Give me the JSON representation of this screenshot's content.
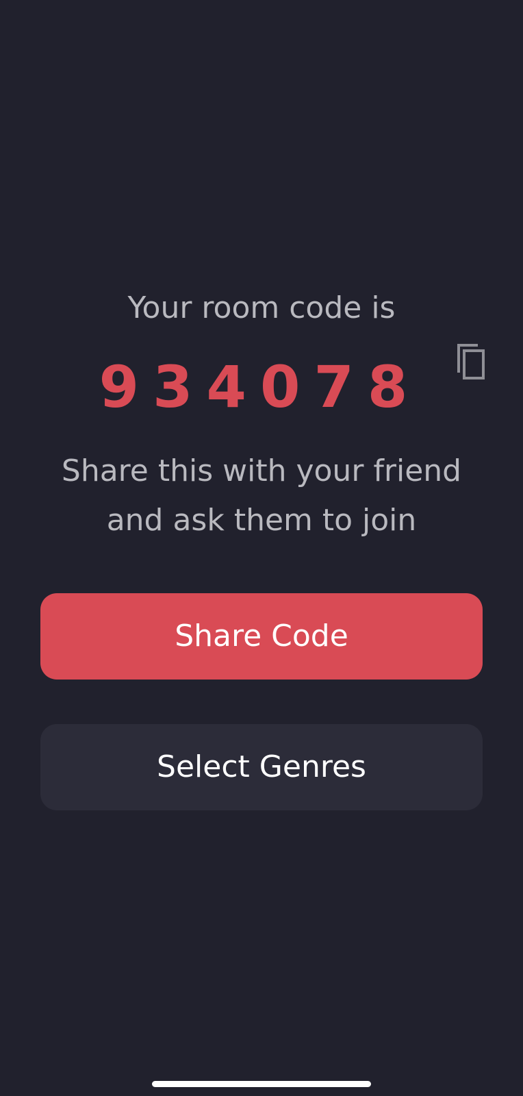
{
  "room": {
    "intro_label": "Your room code is",
    "code": "934078",
    "share_line_1": "Share this with your friend",
    "share_line_2": "and ask them to join"
  },
  "actions": {
    "share_code_label": "Share Code",
    "select_genres_label": "Select Genres"
  },
  "icons": {
    "copy": "copy-icon"
  },
  "colors": {
    "background": "#21212d",
    "accent": "#d94b55",
    "secondary_button": "#2c2c39",
    "muted_text": "#b9b9bf"
  }
}
